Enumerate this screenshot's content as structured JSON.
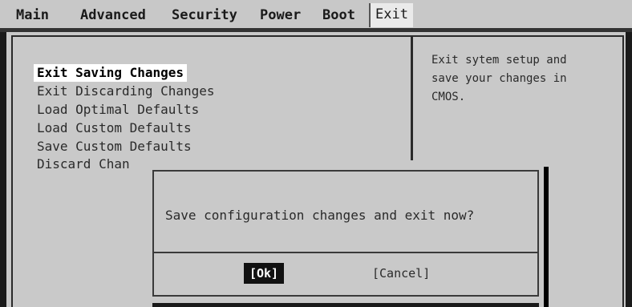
{
  "menubar": {
    "tabs": [
      {
        "label": "Main"
      },
      {
        "label": "Advanced"
      },
      {
        "label": "Security"
      },
      {
        "label": "Power"
      },
      {
        "label": "Boot"
      },
      {
        "label": "Exit"
      }
    ],
    "active_tab": "Exit"
  },
  "exit_menu": {
    "items": [
      {
        "label": "Exit Saving Changes"
      },
      {
        "label": "Exit Discarding Changes"
      },
      {
        "label": "Load Optimal Defaults"
      },
      {
        "label": "Load Custom Defaults"
      },
      {
        "label": "Save Custom Defaults"
      },
      {
        "label": "Discard Chan"
      }
    ],
    "selected_item": "Exit Saving Changes"
  },
  "help": {
    "lines": [
      "Exit sytem setup and",
      "save your changes in",
      "CMOS."
    ]
  },
  "dialog": {
    "message": "Save configuration changes and exit now?",
    "ok_label": "[Ok]",
    "cancel_label": "[Cancel]"
  }
}
